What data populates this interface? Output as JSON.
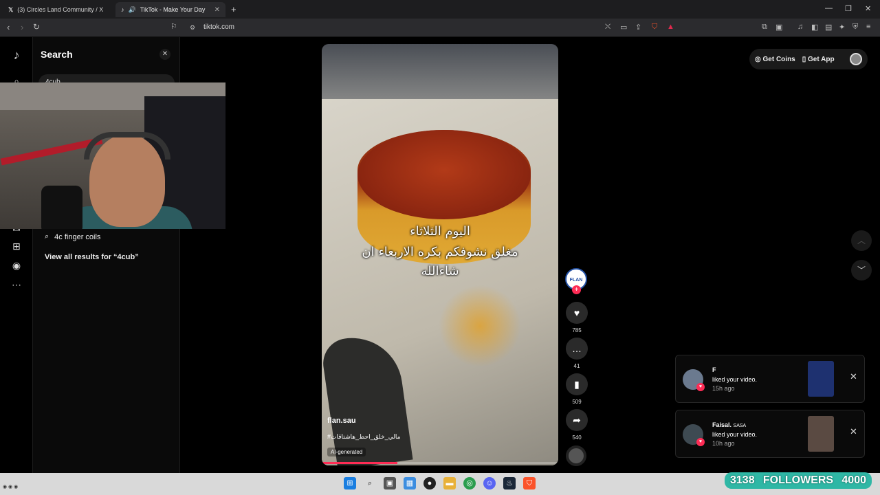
{
  "browser": {
    "tabs": [
      {
        "title": "(3) Circles Land Community / X",
        "icon": "x-logo-icon"
      },
      {
        "title": "TikTok - Make Your Day",
        "icon": "tiktok-icon"
      }
    ],
    "url": "tiktok.com"
  },
  "search": {
    "title": "Search",
    "input_value": "4cub",
    "suggestion": "4c finger coils",
    "view_all": "View all results for “4cub”"
  },
  "video": {
    "caption_line1": "اليوم الثلاثاء",
    "caption_line2": "مغلق نشوفكم بكره الاربعاء ان",
    "caption_line3": "شاءالله",
    "author": "flan.sau",
    "hashtags": "#مالي_خلق_احط_هاشتاقات",
    "ai_label": "AI-generated",
    "progress": 0.32
  },
  "actions": {
    "avatar_label": "FLAN",
    "likes": "785",
    "comments": "41",
    "saves": "509",
    "shares": "540"
  },
  "topright": {
    "get_coins": "Get Coins",
    "get_app": "Get App"
  },
  "notifications": [
    {
      "name": "F",
      "tag": "",
      "message": "liked your video.",
      "time": "15h ago"
    },
    {
      "name": "Faisal.",
      "tag": "SASA",
      "message": "liked your video.",
      "time": "10h ago"
    }
  ],
  "stream": {
    "followers": "3138",
    "label": "FOLLOWERS",
    "goal": "4000"
  },
  "colors": {
    "tiktok_red": "#fe2c55",
    "badge_teal": "#2fb7a5"
  }
}
